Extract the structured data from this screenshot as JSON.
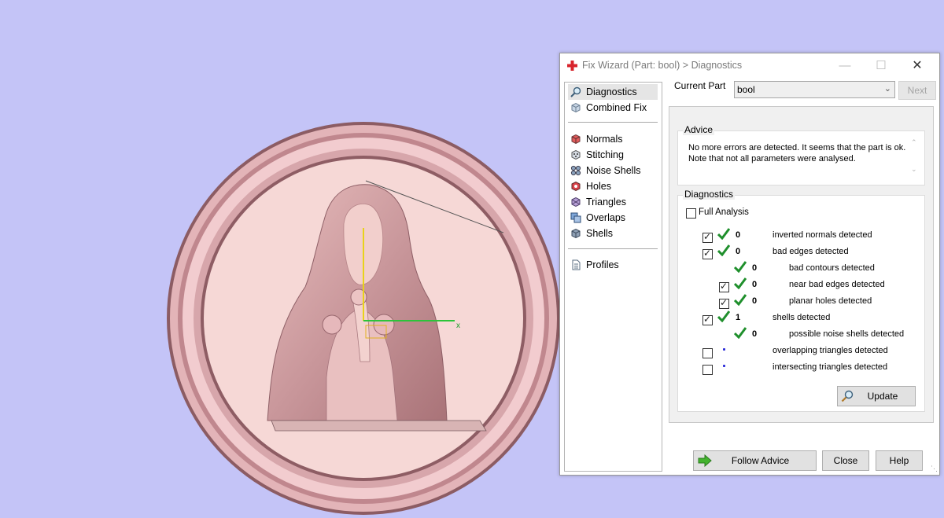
{
  "dialog": {
    "title": "Fix Wizard (Part: bool) > Diagnostics",
    "window_controls": {
      "minimize": "—",
      "maximize": "☐",
      "close": "✕"
    }
  },
  "nav": {
    "items": [
      {
        "label": "Diagnostics",
        "icon": "magnifier-icon",
        "selected": true
      },
      {
        "label": "Combined Fix",
        "icon": "cube-icon"
      },
      {
        "label": "Normals",
        "icon": "normals-icon"
      },
      {
        "label": "Stitching",
        "icon": "stitching-icon"
      },
      {
        "label": "Noise Shells",
        "icon": "noise-shells-icon"
      },
      {
        "label": "Holes",
        "icon": "holes-icon"
      },
      {
        "label": "Triangles",
        "icon": "triangles-icon"
      },
      {
        "label": "Overlaps",
        "icon": "overlaps-icon"
      },
      {
        "label": "Shells",
        "icon": "shells-icon"
      },
      {
        "label": "Profiles",
        "icon": "profiles-icon"
      }
    ]
  },
  "current_part": {
    "label": "Current Part",
    "value": "bool",
    "next_label": "Next"
  },
  "advice": {
    "title": "Advice",
    "text": "No more errors are detected. It seems that the part is ok. Note that not all parameters were analysed."
  },
  "diagnostics": {
    "title": "Diagnostics",
    "full_analysis_label": "Full Analysis",
    "full_analysis_checked": false,
    "rows": [
      {
        "checkbox": true,
        "checked": true,
        "status": "check",
        "value": "0",
        "label": "inverted normals detected",
        "indent": 0
      },
      {
        "checkbox": true,
        "checked": true,
        "status": "check",
        "value": "0",
        "label": "bad edges detected",
        "indent": 0
      },
      {
        "checkbox": false,
        "checked": false,
        "status": "check",
        "value": "0",
        "label": "bad contours detected",
        "indent": 1
      },
      {
        "checkbox": true,
        "checked": true,
        "status": "check",
        "value": "0",
        "label": "near bad edges detected",
        "indent": 1
      },
      {
        "checkbox": true,
        "checked": true,
        "status": "check",
        "value": "0",
        "label": "planar holes detected",
        "indent": 1
      },
      {
        "checkbox": true,
        "checked": true,
        "status": "check",
        "value": "1",
        "label": "shells detected",
        "indent": 0
      },
      {
        "checkbox": false,
        "checked": false,
        "status": "check",
        "value": "0",
        "label": "possible noise shells detected",
        "indent": 1
      },
      {
        "checkbox": true,
        "checked": false,
        "status": "dot",
        "value": "",
        "label": "overlapping triangles detected",
        "indent": 0
      },
      {
        "checkbox": true,
        "checked": false,
        "status": "dot",
        "value": "",
        "label": "intersecting triangles detected",
        "indent": 0
      }
    ],
    "update_label": "Update"
  },
  "buttons": {
    "follow_advice": "Follow Advice",
    "close": "Close",
    "help": "Help"
  },
  "viewport": {
    "axis_x_label": "x",
    "background": "#c4c4f7",
    "model_color": "#f0cfcf"
  }
}
